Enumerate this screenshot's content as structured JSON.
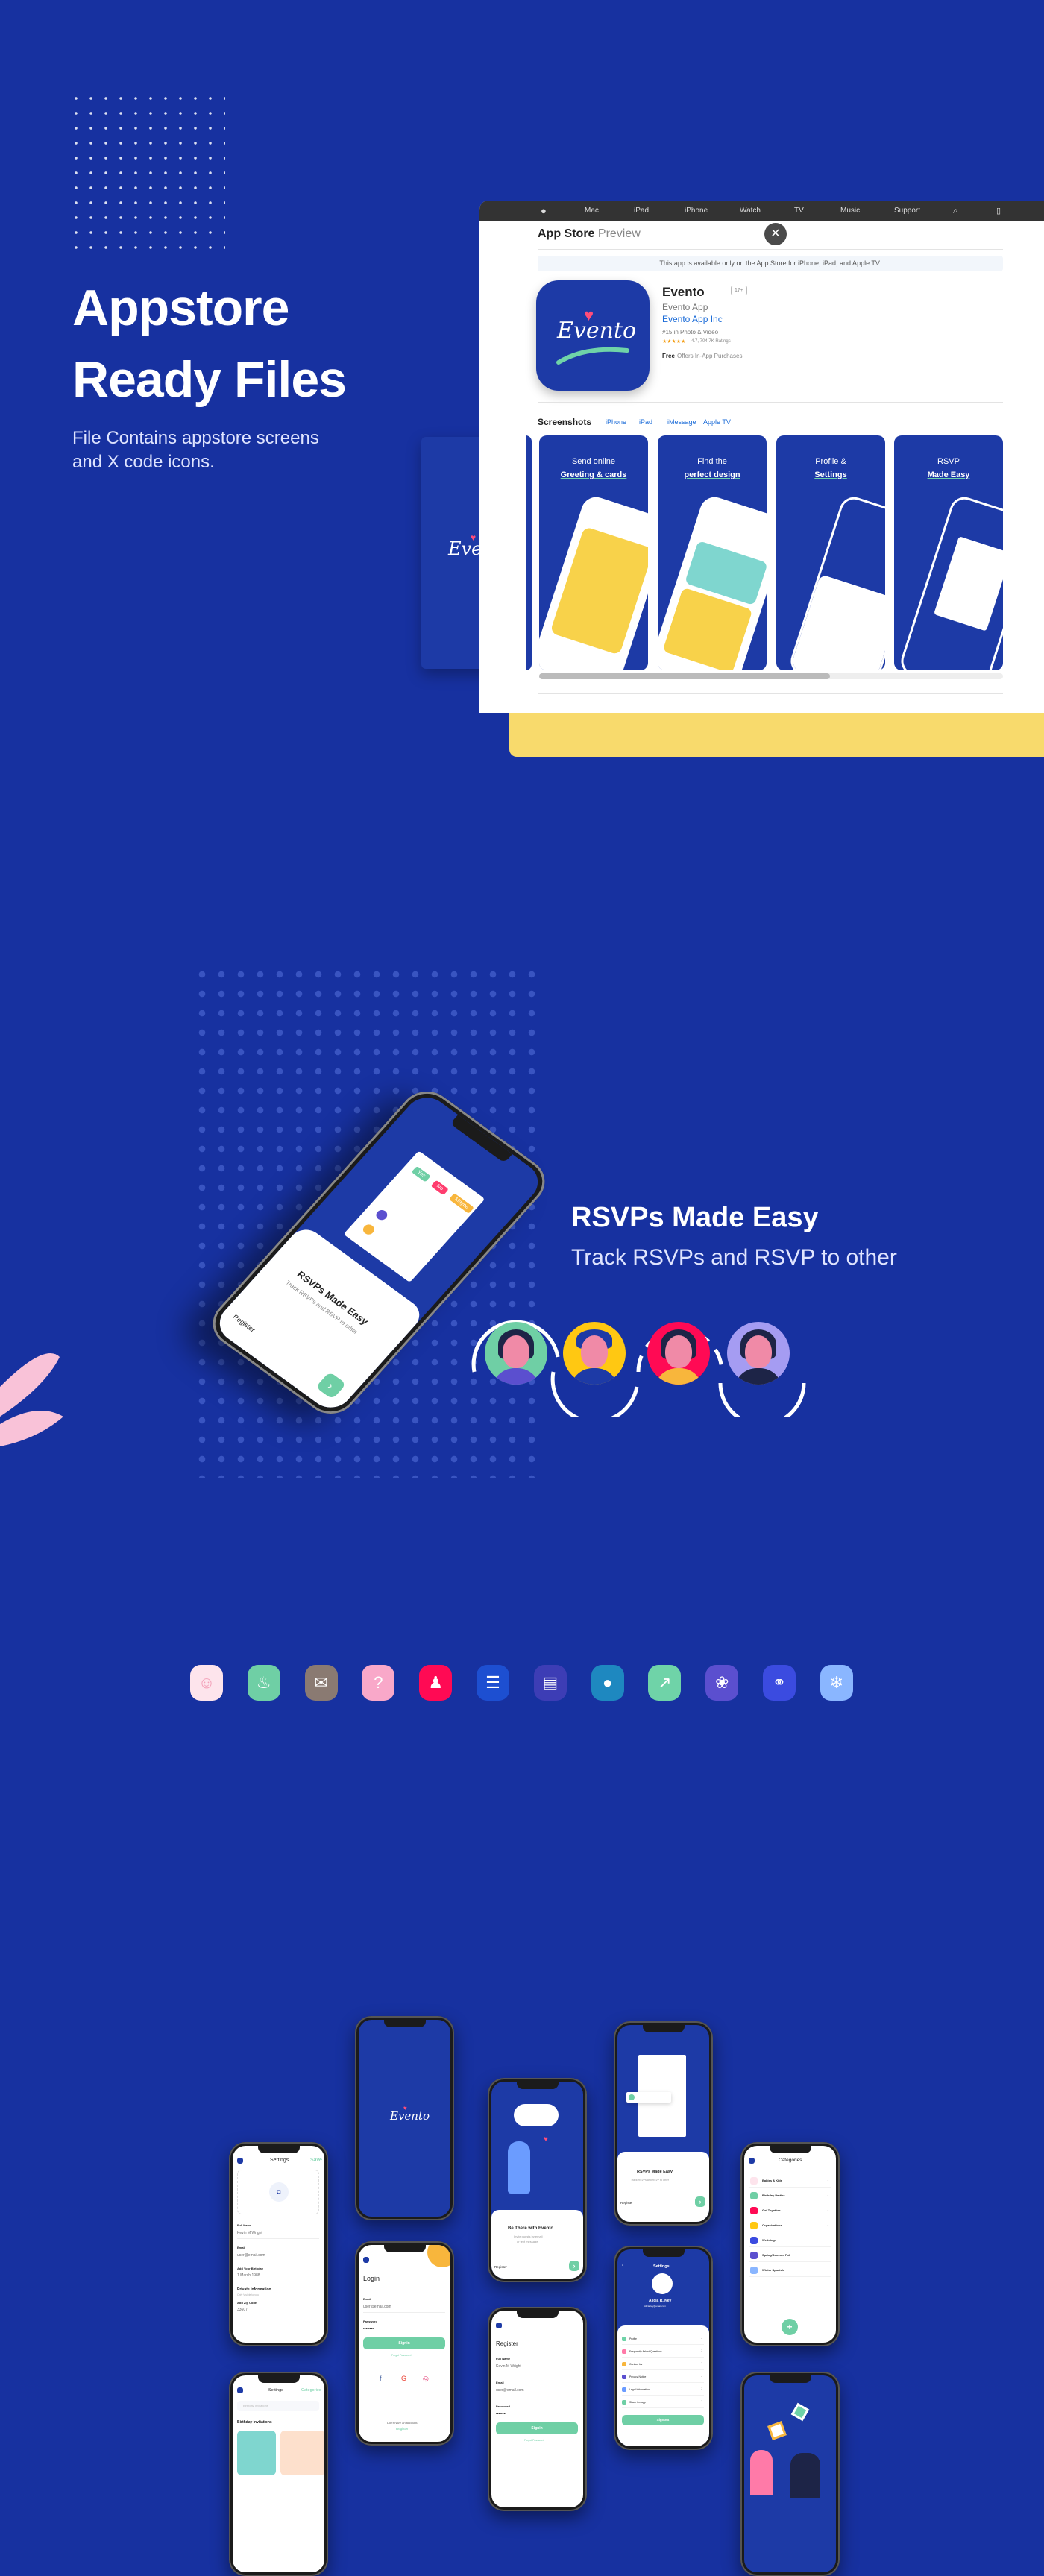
{
  "hero": {
    "title_line1": "Appstore",
    "title_line2": "Ready Files",
    "subtitle_line1": "File Contains appstore screens",
    "subtitle_line2": "and X code icons."
  },
  "brand": {
    "logo_text": "Evento"
  },
  "appstore": {
    "nav": [
      "Mac",
      "iPad",
      "iPhone",
      "Watch",
      "TV",
      "Music",
      "Support"
    ],
    "title": "App Store",
    "title_suffix": "Preview",
    "close": "✕",
    "banner": "This app is available only on the App Store for iPhone, iPad, and Apple TV.",
    "app_name": "Evento",
    "age_rating": "17+",
    "subtitle": "Evento App",
    "developer": "Evento App Inc",
    "rank": "#15 in Photo & Video",
    "stars": "★★★★★",
    "rating": "4.7, 704.7K Ratings",
    "price": "Free",
    "iap": "Offers In-App Purchases",
    "screenshots_label": "Screenshots",
    "tabs": [
      "iPhone",
      "iPad",
      "iMessage",
      "Apple TV"
    ],
    "shots": [
      {
        "l1": "Send online",
        "l2": "Greeting & cards"
      },
      {
        "l1": "Find the",
        "l2": "perfect design"
      },
      {
        "l1": "Profile &",
        "l2": "Settings"
      },
      {
        "l1": "RSVP",
        "l2": "Made Easy"
      }
    ]
  },
  "rsvp": {
    "title": "RSVPs Made Easy",
    "subtitle": "Track RSVPs and  RSVP to other",
    "phone_title": "RSVPs Made Easy",
    "phone_sub": "Track RSVPs and RSVP to other",
    "register": "Register",
    "yes": "Yes",
    "no": "No",
    "maybe": "Maybe"
  },
  "icons": [
    {
      "name": "baby-icon",
      "glyph": "☺",
      "color": "#fde4ec"
    },
    {
      "name": "birthday-cake-icon",
      "glyph": "♨",
      "color": "#6fcfa5"
    },
    {
      "name": "envelope-icon",
      "glyph": "✉",
      "color": "#8a7a72"
    },
    {
      "name": "question-icon",
      "glyph": "?",
      "color": "#f9a8c9"
    },
    {
      "name": "group-icon",
      "glyph": "♟",
      "color": "#ff0a54"
    },
    {
      "name": "scroll-icon",
      "glyph": "☰",
      "color": "#1d4fd1"
    },
    {
      "name": "clipboard-icon",
      "glyph": "▤",
      "color": "#3d3db5"
    },
    {
      "name": "person-icon",
      "glyph": "●",
      "color": "#1e88c0"
    },
    {
      "name": "share-icon",
      "glyph": "↗",
      "color": "#6fd3a8"
    },
    {
      "name": "lotus-icon",
      "glyph": "❀",
      "color": "#5b4fcf"
    },
    {
      "name": "rings-icon",
      "glyph": "⚭",
      "color": "#3b4be0"
    },
    {
      "name": "snowflake-icon",
      "glyph": "❄",
      "color": "#8ab6ff"
    }
  ],
  "screens": {
    "settings": {
      "title": "Settings",
      "save": "Save",
      "full_name_label": "Full Name",
      "full_name": "Kevin M Wright",
      "email_label": "Email",
      "email": "user@email.com",
      "birthday_label": "Add Your Birthday",
      "birthday": "1 March 1988",
      "private": "Private Information",
      "private_sub": "Only Visible to you",
      "zip_label": "Add Zip Code",
      "zip": "33607"
    },
    "onboard": {
      "title": "Be There with Evento",
      "sub1": "Invite guests by email",
      "sub2": "or text message",
      "register": "Register"
    },
    "rsvp": {
      "title": "RSVPs Made Easy",
      "sub": "Track RSVPs and RSVP to other",
      "register": "Register"
    },
    "categories": {
      "title": "Categories",
      "items": [
        "Babies & Kids",
        "Birthday Parties",
        "Get Together",
        "Organizations",
        "Weddings",
        "Spring/Summer Fall",
        "Winter Spanish"
      ]
    },
    "login": {
      "title": "Login",
      "email_label": "Email",
      "email": "user@email.com",
      "password_label": "Password",
      "password": "••••••••",
      "signin": "Signin",
      "forgot": "Forgot Password",
      "no_account": "Don't have an account?",
      "register": "Register"
    },
    "register": {
      "title": "Register",
      "full_name_label": "Full Name",
      "full_name": "Kevin M Wright",
      "email_label": "Email",
      "email": "user@email.com",
      "password_label": "Password",
      "password": "••••••••",
      "signin": "Signin",
      "forgot": "Forgot Password"
    },
    "profile": {
      "title": "Settings",
      "name": "Alicia R. Key",
      "email": "AliciaKey@email.com",
      "items": [
        "Profile",
        "Frequently Asked Questions",
        "Contact Us",
        "Privacy Notice",
        "Legal Information",
        "Share the app"
      ],
      "signout": "Signout"
    },
    "gallery": {
      "title": "Settings",
      "categories": "Categories",
      "search": "Birthday Invitations",
      "section": "Birthday Invitations"
    }
  },
  "colors": {
    "background": "#1731a0",
    "accent_green": "#6fcfa5",
    "yellow": "#f8da6c",
    "pink": "#ff3d6e"
  }
}
